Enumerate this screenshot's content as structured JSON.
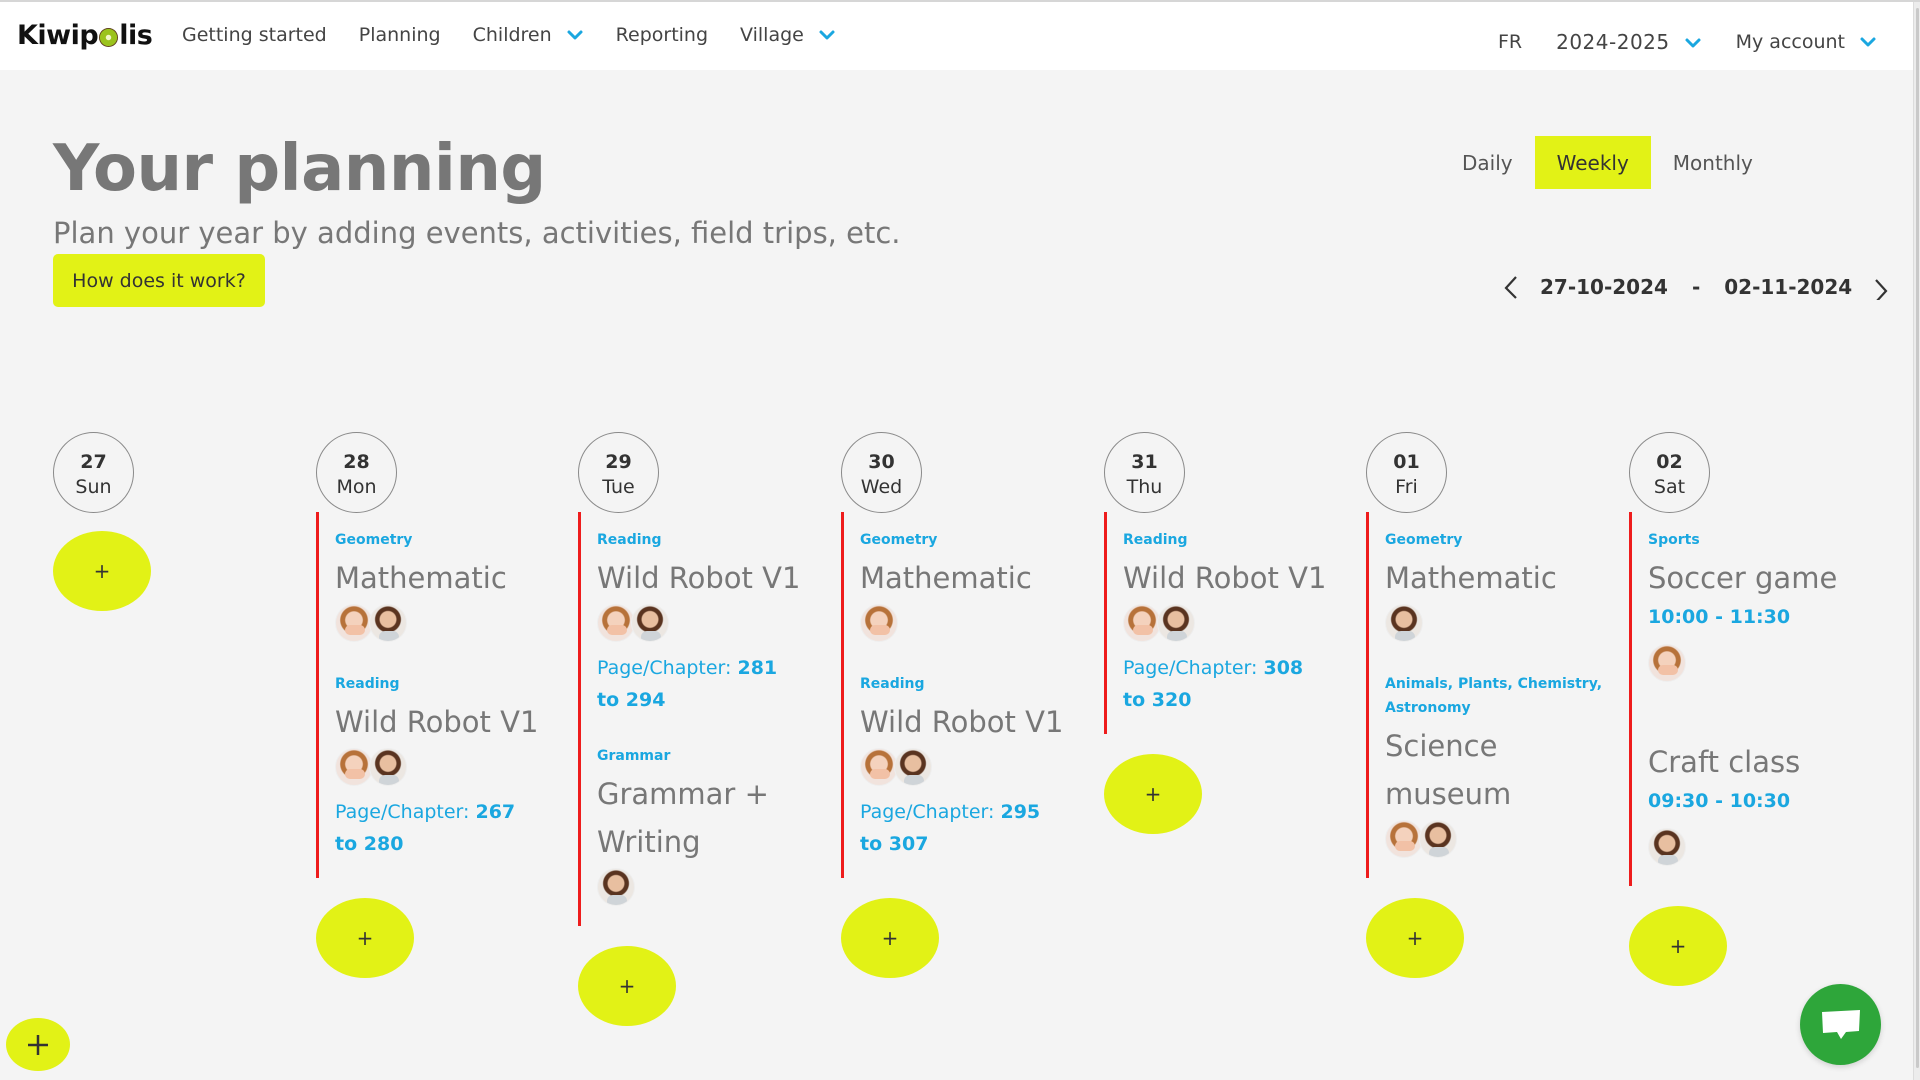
{
  "header": {
    "logo_text_pre": "Kiwip",
    "logo_text_post": "lis",
    "nav": [
      {
        "label": "Getting started",
        "dropdown": false
      },
      {
        "label": "Planning",
        "dropdown": false
      },
      {
        "label": "Children",
        "dropdown": true
      },
      {
        "label": "Reporting",
        "dropdown": false
      },
      {
        "label": "Village",
        "dropdown": true
      }
    ],
    "language": "FR",
    "school_year": "2024-2025",
    "account_label": "My account"
  },
  "page": {
    "title": "Your planning",
    "subtitle": "Plan your year by adding events, activities, field trips, etc.",
    "help_button": "How does it work?"
  },
  "view_toggle": {
    "options": [
      "Daily",
      "Weekly",
      "Monthly"
    ],
    "selected": "Weekly"
  },
  "date_range": {
    "start": "27-10-2024",
    "separator": "-",
    "end": "02-11-2024"
  },
  "colors": {
    "accent_yellow": "#e2f216",
    "category_blue": "#1aa7e0",
    "event_line_red": "#ee1c1c",
    "chat_green": "#2ea63a"
  },
  "add_label": "+",
  "pages_prefix": "Page/Chapter: ",
  "days": [
    {
      "num": "27",
      "name": "Sun",
      "events": []
    },
    {
      "num": "28",
      "name": "Mon",
      "events": [
        {
          "category": "Geometry",
          "title": "Mathematic",
          "children": [
            "girl",
            "boy"
          ]
        },
        {
          "category": "Reading",
          "title": "Wild Robot V1",
          "children": [
            "girl",
            "boy"
          ],
          "pages_from": "267",
          "pages_to": "to 280"
        }
      ]
    },
    {
      "num": "29",
      "name": "Tue",
      "events": [
        {
          "category": "Reading",
          "title": "Wild Robot V1",
          "children": [
            "girl",
            "boy"
          ],
          "pages_from": "281",
          "pages_to": "to 294"
        },
        {
          "category": "Grammar",
          "title": "Grammar + Writing",
          "children": [
            "boy"
          ]
        }
      ]
    },
    {
      "num": "30",
      "name": "Wed",
      "events": [
        {
          "category": "Geometry",
          "title": "Mathematic",
          "children": [
            "girl"
          ]
        },
        {
          "category": "Reading",
          "title": "Wild Robot V1",
          "children": [
            "girl",
            "boy"
          ],
          "pages_from": "295",
          "pages_to": "to 307"
        }
      ]
    },
    {
      "num": "31",
      "name": "Thu",
      "events": [
        {
          "category": "Reading",
          "title": "Wild Robot V1",
          "children": [
            "girl",
            "boy"
          ],
          "pages_from": "308",
          "pages_to": "to 320"
        }
      ]
    },
    {
      "num": "01",
      "name": "Fri",
      "events": [
        {
          "category": "Geometry",
          "title": "Mathematic",
          "children": [
            "boy"
          ]
        },
        {
          "category": "Animals, Plants, Chemistry, Astronomy",
          "title": "Science museum",
          "children": [
            "girl",
            "boy"
          ]
        }
      ]
    },
    {
      "num": "02",
      "name": "Sat",
      "events": [
        {
          "category": "Sports",
          "title": "Soccer game",
          "time": "10:00 - 11:30",
          "children": [
            "girl"
          ]
        },
        {
          "category": "",
          "title": "Craft class",
          "time": "09:30 - 10:30",
          "children": [
            "boy"
          ]
        }
      ]
    }
  ]
}
